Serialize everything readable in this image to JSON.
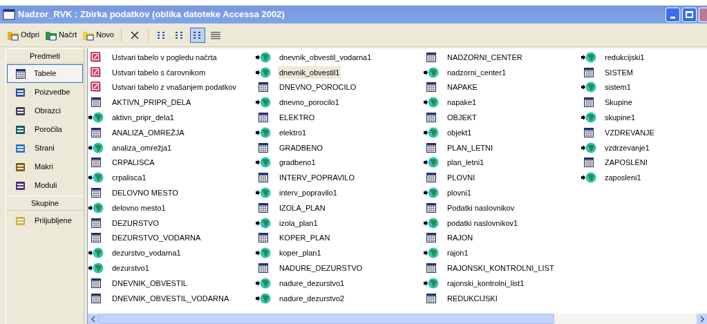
{
  "window": {
    "title": "Nadzor_RVK : Zbirka podatkov (oblika datoteke Accessa 2002)"
  },
  "toolbar": {
    "buttons": [
      {
        "label": "Odpri",
        "kind": "open"
      },
      {
        "label": "Načrt",
        "kind": "design"
      },
      {
        "label": "Novo",
        "kind": "new"
      }
    ],
    "views": [
      {
        "kind": "large",
        "selected": false
      },
      {
        "kind": "small",
        "selected": false
      },
      {
        "kind": "list",
        "selected": true
      },
      {
        "kind": "details",
        "selected": false
      }
    ]
  },
  "sidebar": {
    "groups": [
      {
        "title": "Predmeti",
        "items": [
          {
            "label": "Tabele",
            "kind": "tables",
            "selected": true
          },
          {
            "label": "Poizvedbe",
            "kind": "queries",
            "selected": false
          },
          {
            "label": "Obrazci",
            "kind": "forms",
            "selected": false
          },
          {
            "label": "Poročila",
            "kind": "reports",
            "selected": false
          },
          {
            "label": "Strani",
            "kind": "pages",
            "selected": false
          },
          {
            "label": "Makri",
            "kind": "macros",
            "selected": false
          },
          {
            "label": "Moduli",
            "kind": "modules",
            "selected": false
          }
        ]
      },
      {
        "title": "Skupine",
        "items": [
          {
            "label": "Priljubljene",
            "kind": "favorites",
            "selected": false
          }
        ]
      }
    ]
  },
  "objects": [
    {
      "label": "Ustvari tabelo v pogledu načrta",
      "kind": "wizard",
      "selected": false
    },
    {
      "label": "Ustvari tabelo s čarovnikom",
      "kind": "wizard",
      "selected": false
    },
    {
      "label": "Ustvari tabelo z vnašanjem podatkov",
      "kind": "wizard",
      "selected": false
    },
    {
      "label": "AKTIVN_PRIPR_DELA",
      "kind": "table",
      "selected": false
    },
    {
      "label": "aktivn_pripr_dela1",
      "kind": "link",
      "selected": false
    },
    {
      "label": "ANALIZA_OMREŽJA",
      "kind": "table",
      "selected": false
    },
    {
      "label": "analiza_omrežja1",
      "kind": "link",
      "selected": false
    },
    {
      "label": "CRPALISCA",
      "kind": "table",
      "selected": false
    },
    {
      "label": "crpalisca1",
      "kind": "link",
      "selected": false
    },
    {
      "label": "DELOVNO MESTO",
      "kind": "table",
      "selected": false
    },
    {
      "label": "delovno mesto1",
      "kind": "link",
      "selected": false
    },
    {
      "label": "DEZURSTVO",
      "kind": "table",
      "selected": false
    },
    {
      "label": "DEZURSTVO_VODARNA",
      "kind": "table",
      "selected": false
    },
    {
      "label": "dezurstvo_vodarna1",
      "kind": "link",
      "selected": false
    },
    {
      "label": "dezurstvo1",
      "kind": "link",
      "selected": false
    },
    {
      "label": "DNEVNIK_OBVESTIL",
      "kind": "table",
      "selected": false
    },
    {
      "label": "DNEVNIK_OBVESTIL_VODARNA",
      "kind": "table",
      "selected": false
    },
    {
      "label": "dnevnik_obvestil_vodarna1",
      "kind": "link",
      "selected": false
    },
    {
      "label": "dnevnik_obvestil1",
      "kind": "link",
      "selected": true
    },
    {
      "label": "DNEVNO_POROCILO",
      "kind": "table",
      "selected": false
    },
    {
      "label": "dnevno_porocilo1",
      "kind": "link",
      "selected": false
    },
    {
      "label": "ELEKTRO",
      "kind": "table",
      "selected": false
    },
    {
      "label": "elektro1",
      "kind": "link",
      "selected": false
    },
    {
      "label": "GRADBENO",
      "kind": "table",
      "selected": false
    },
    {
      "label": "gradbeno1",
      "kind": "link",
      "selected": false
    },
    {
      "label": "INTERV_POPRAVILO",
      "kind": "table",
      "selected": false
    },
    {
      "label": "interv_popravilo1",
      "kind": "link",
      "selected": false
    },
    {
      "label": "IZOLA_PLAN",
      "kind": "table",
      "selected": false
    },
    {
      "label": "izola_plan1",
      "kind": "link",
      "selected": false
    },
    {
      "label": "KOPER_PLAN",
      "kind": "table",
      "selected": false
    },
    {
      "label": "koper_plan1",
      "kind": "link",
      "selected": false
    },
    {
      "label": "NADURE_DEZURSTVO",
      "kind": "table",
      "selected": false
    },
    {
      "label": "nadure_dezurstvo1",
      "kind": "link",
      "selected": false
    },
    {
      "label": "nadure_dezurstvo2",
      "kind": "link",
      "selected": false
    },
    {
      "label": "NADZORNI_CENTER",
      "kind": "table",
      "selected": false
    },
    {
      "label": "nadzorni_center1",
      "kind": "link",
      "selected": false
    },
    {
      "label": "NAPAKE",
      "kind": "table",
      "selected": false
    },
    {
      "label": "napake1",
      "kind": "link",
      "selected": false
    },
    {
      "label": "OBJEKT",
      "kind": "table",
      "selected": false
    },
    {
      "label": "objekt1",
      "kind": "link",
      "selected": false
    },
    {
      "label": "PLAN_LETNI",
      "kind": "table",
      "selected": false
    },
    {
      "label": "plan_letni1",
      "kind": "link",
      "selected": false
    },
    {
      "label": "PLOVNI",
      "kind": "table",
      "selected": false
    },
    {
      "label": "plovni1",
      "kind": "link",
      "selected": false
    },
    {
      "label": "Podatki naslovnikov",
      "kind": "table",
      "selected": false
    },
    {
      "label": "podatki naslovnikov1",
      "kind": "link",
      "selected": false
    },
    {
      "label": "RAJON",
      "kind": "table",
      "selected": false
    },
    {
      "label": "rajon1",
      "kind": "link",
      "selected": false
    },
    {
      "label": "RAJONSKI_KONTROLNI_LIST",
      "kind": "table",
      "selected": false
    },
    {
      "label": "rajonski_kontrolni_list1",
      "kind": "link",
      "selected": false
    },
    {
      "label": "REDUKCIJSKI",
      "kind": "table",
      "selected": false
    },
    {
      "label": "redukcijski1",
      "kind": "link",
      "selected": false
    },
    {
      "label": "SISTEM",
      "kind": "table",
      "selected": false
    },
    {
      "label": "sistem1",
      "kind": "link",
      "selected": false
    },
    {
      "label": "Skupine",
      "kind": "table",
      "selected": false
    },
    {
      "label": "skupine1",
      "kind": "link",
      "selected": false
    },
    {
      "label": "VZDREVANJE",
      "kind": "table",
      "selected": false
    },
    {
      "label": "vzdrzevanje1",
      "kind": "link",
      "selected": false
    },
    {
      "label": "ZAPOSLENI",
      "kind": "table",
      "selected": false
    },
    {
      "label": "zaposleni1",
      "kind": "link",
      "selected": false
    }
  ]
}
